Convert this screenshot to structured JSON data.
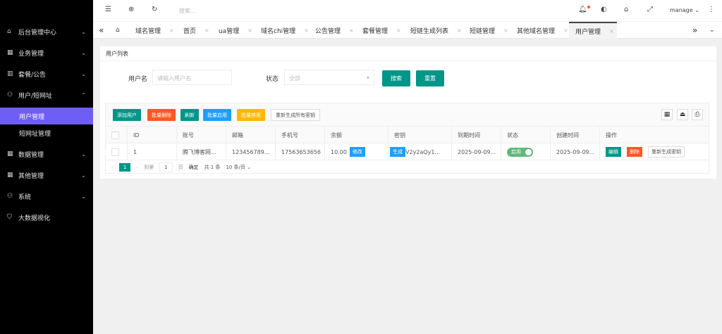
{
  "sidebar": {
    "items": [
      {
        "label": "后台管理中心",
        "icon": "home-icon",
        "expanded": false
      },
      {
        "label": "业务管理",
        "icon": "grid-icon",
        "expanded": false
      },
      {
        "label": "套餐/公告",
        "icon": "table-icon",
        "expanded": false
      },
      {
        "label": "用户/短网址",
        "icon": "user-icon",
        "expanded": true
      },
      {
        "label": "用户管理",
        "sub": true,
        "active": true
      },
      {
        "label": "短网址管理",
        "sub": true
      },
      {
        "label": "数据管理",
        "icon": "grid-icon"
      },
      {
        "label": "其他管理",
        "icon": "grid-icon"
      },
      {
        "label": "系统",
        "icon": "user-icon"
      },
      {
        "label": "大数据视化",
        "icon": "shield-icon"
      }
    ]
  },
  "topbar": {
    "search_placeholder": "搜索...",
    "user": "manage"
  },
  "tabs": [
    "域名管理",
    "首页",
    "ua管理",
    "域名chi管理",
    "公告管理",
    "套餐管理",
    "短链生成列表",
    "短链管理",
    "其他域名管理",
    "用户管理"
  ],
  "card": {
    "title": "用户列表",
    "filters": {
      "username_label": "用户名",
      "username_placeholder": "请输入用户名",
      "status_label": "状态",
      "status_value": "全部",
      "search": "搜索",
      "reset": "重置"
    },
    "toolbar": {
      "add": "添加用户",
      "batch_delete": "批量删除",
      "refresh": "刷新",
      "batch_enable": "批量启用",
      "batch_disable": "批量禁用",
      "regen_all": "重新生成所有密钥"
    },
    "columns": [
      "ID",
      "账号",
      "邮箱",
      "手机号",
      "余额",
      "密钥",
      "到期时间",
      "状态",
      "创建时间",
      "操作"
    ],
    "rows": [
      {
        "id": "1",
        "account": "腾飞博客网...",
        "email": "123456789...",
        "phone": "17563653656",
        "balance": "10.00",
        "balance_btn": "修改",
        "key_btn": "生成",
        "key": "V2y2aQy1...",
        "expire": "2025-09-09...",
        "status": "启用",
        "created": "2025-09-09...",
        "edit": "编辑",
        "delete": "删除",
        "regen": "重新生成密钥"
      }
    ],
    "pager": {
      "page": "1",
      "goto": "到第",
      "goto_value": "1",
      "page_unit": "页",
      "confirm": "确定",
      "total": "共 1 条",
      "per_page": "10 条/页"
    }
  },
  "colors": {
    "teal": "#009688",
    "orange": "#ff5722",
    "blue": "#1e9fff",
    "yellow": "#ffb800",
    "active": "#6f5ef5"
  }
}
